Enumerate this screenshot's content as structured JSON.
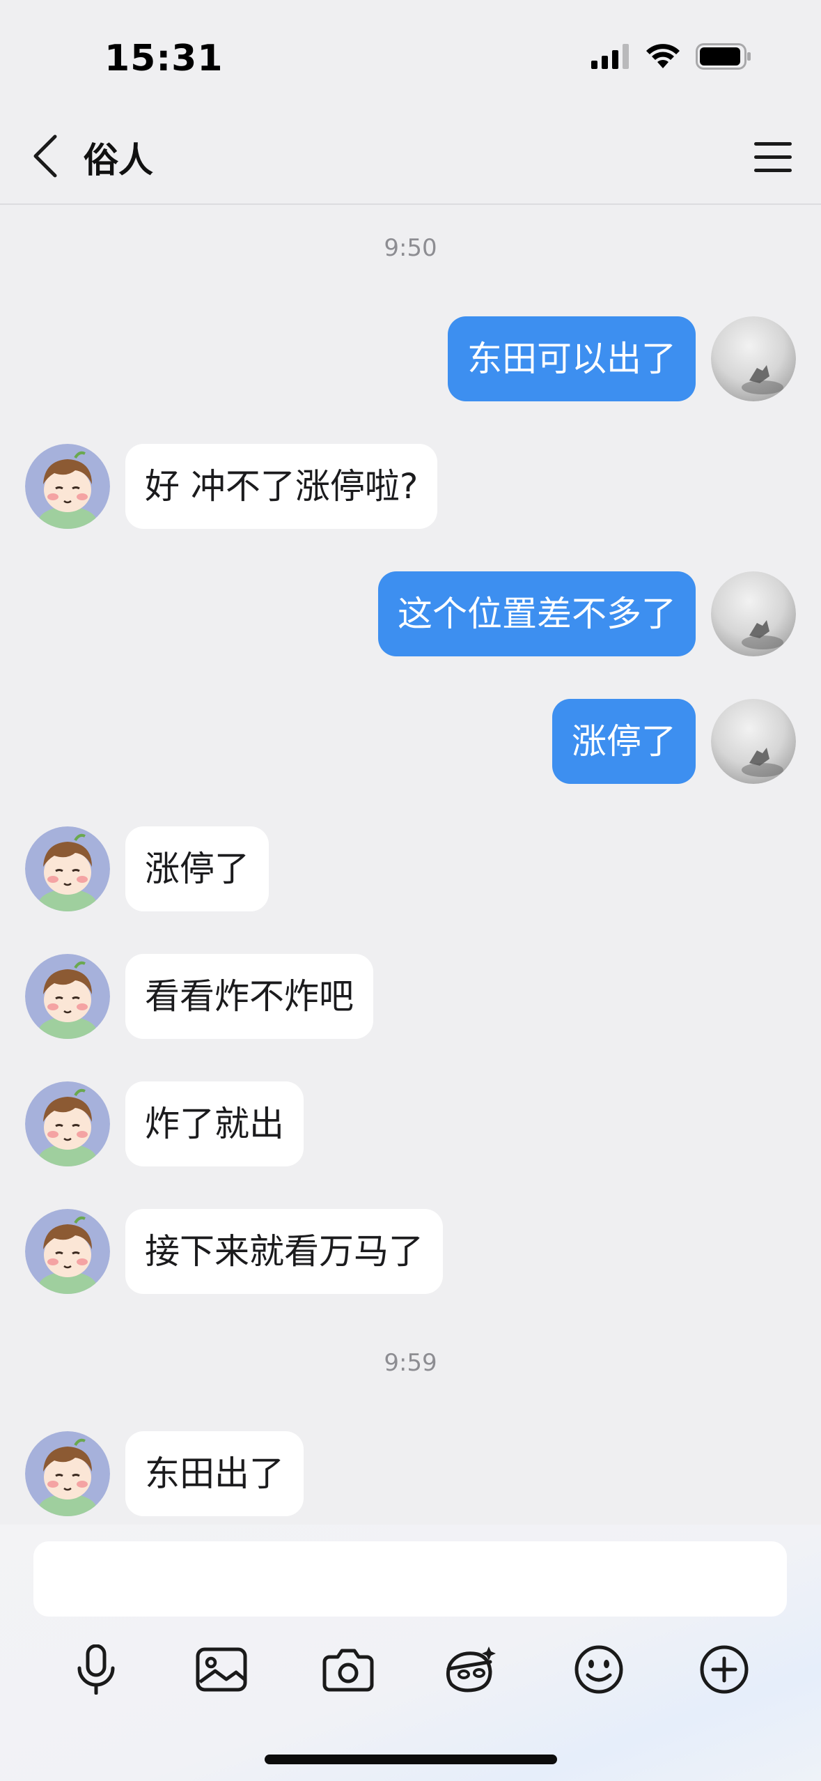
{
  "status_bar": {
    "time": "15:31",
    "icons": [
      "cellular-signal-icon",
      "wifi-icon",
      "battery-icon"
    ]
  },
  "nav": {
    "title": "俗人",
    "back_icon": "chevron-left-icon",
    "menu_icon": "hamburger-menu-icon"
  },
  "chat": {
    "timestamps": [
      "9:50",
      "9:59"
    ],
    "messages": [
      {
        "direction": "out",
        "text": "东田可以出了"
      },
      {
        "direction": "in",
        "text": "好  冲不了涨停啦?"
      },
      {
        "direction": "out",
        "text": "这个位置差不多了"
      },
      {
        "direction": "out",
        "text": "涨停了"
      },
      {
        "direction": "in",
        "text": "涨停了"
      },
      {
        "direction": "in",
        "text": "看看炸不炸吧"
      },
      {
        "direction": "in",
        "text": "炸了就出"
      },
      {
        "direction": "in",
        "text": "接下来就看万马了"
      },
      {
        "direction": "in",
        "text": "东田出了"
      }
    ]
  },
  "input": {
    "value": "",
    "placeholder": ""
  },
  "toolbar": {
    "icons": [
      "microphone-icon",
      "image-icon",
      "camera-icon",
      "ai-assistant-icon",
      "emoji-icon",
      "plus-icon"
    ]
  },
  "colors": {
    "background": "#efeff1",
    "outgoing_bubble": "#3d8ff0",
    "incoming_bubble": "#ffffff",
    "timestamp_text": "#8d8d92"
  }
}
